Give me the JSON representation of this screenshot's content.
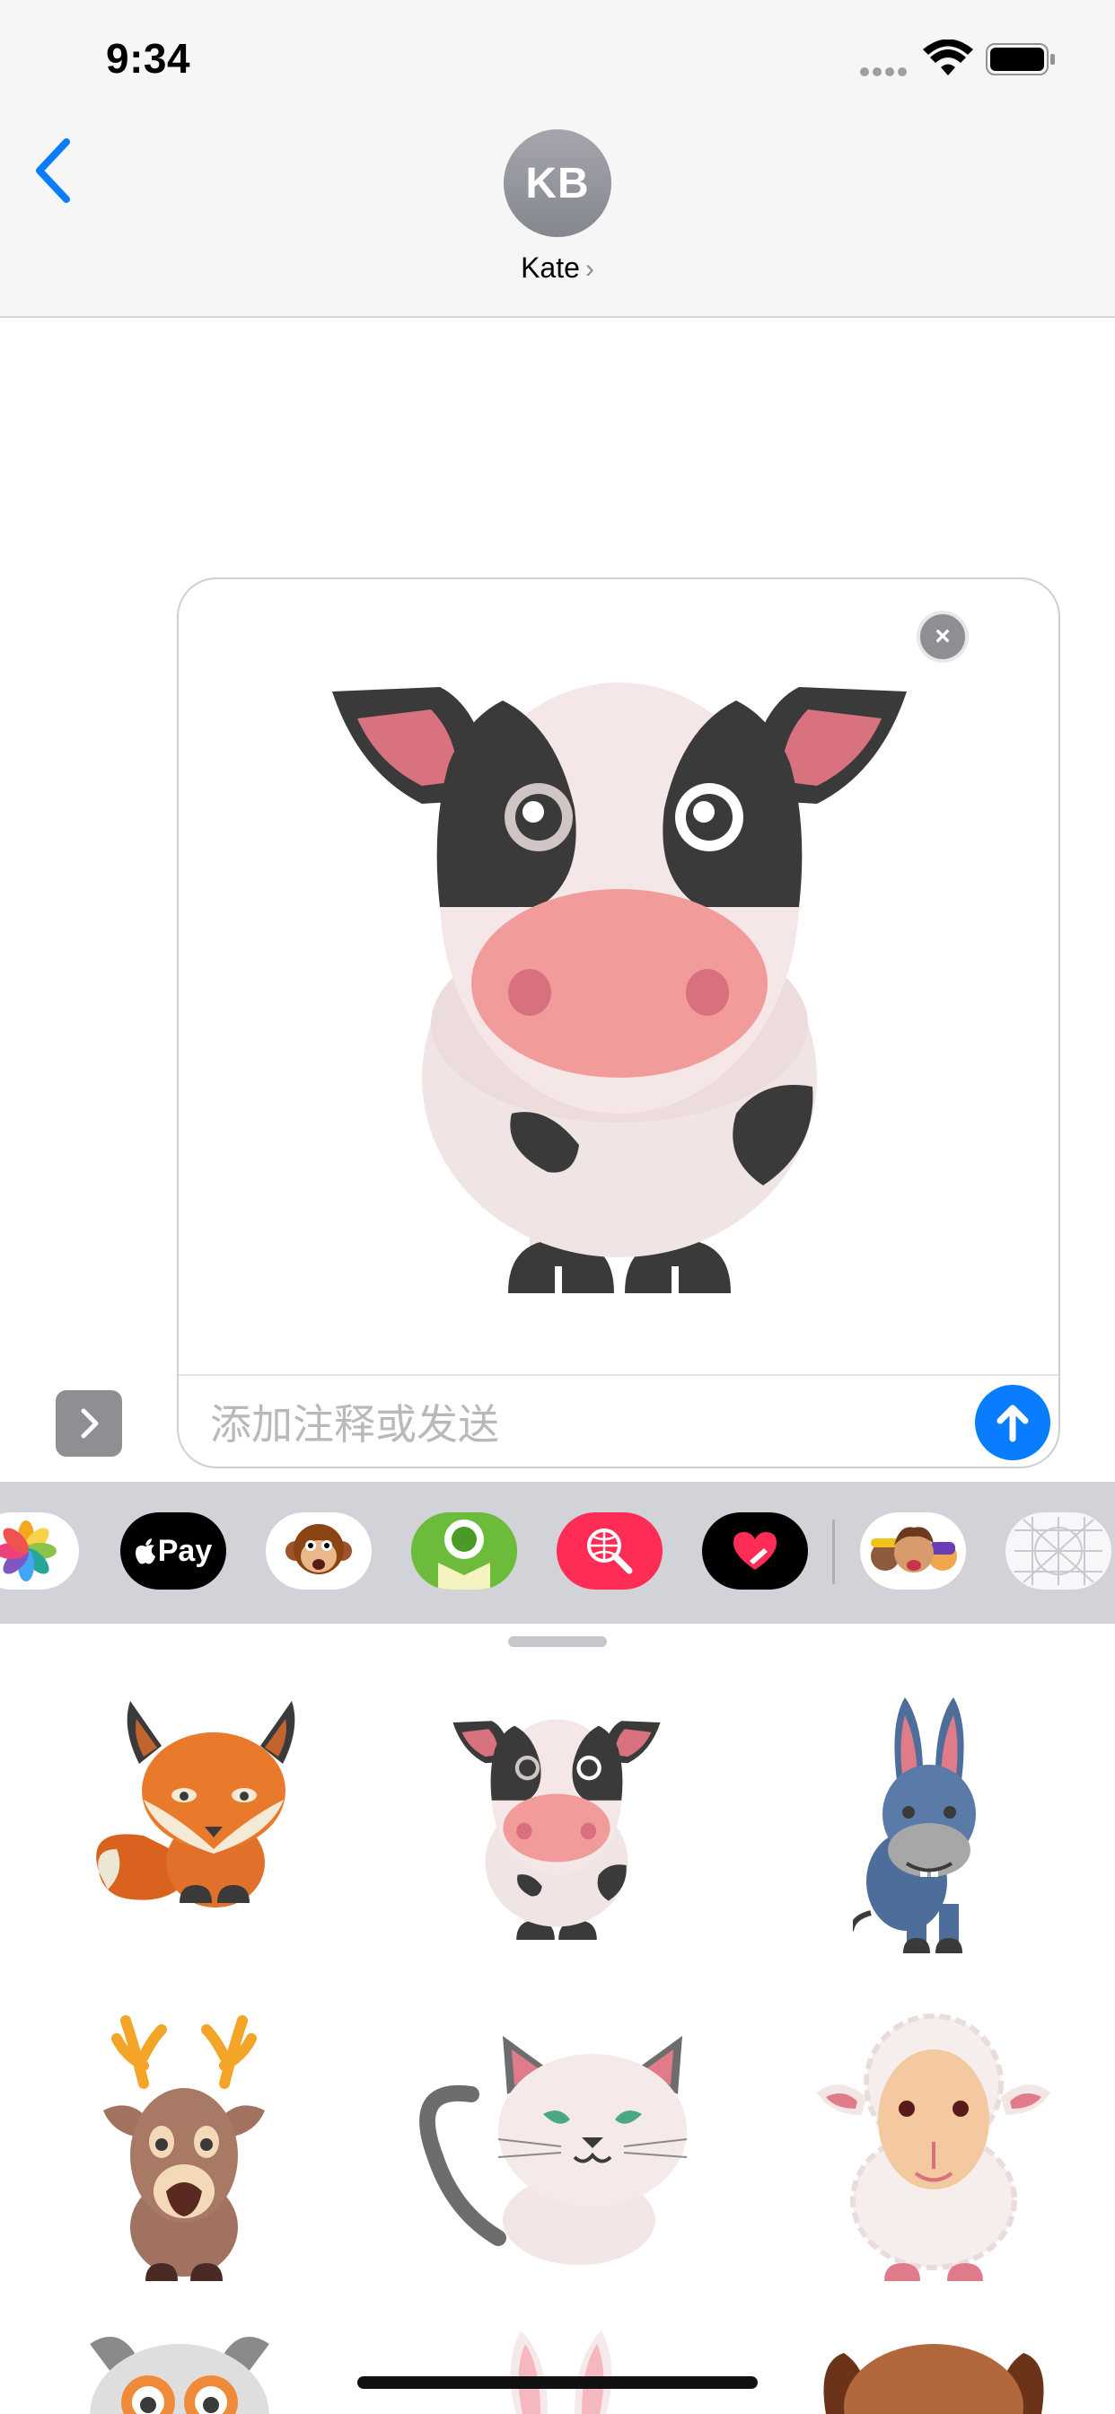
{
  "status_bar": {
    "time": "9:34"
  },
  "header": {
    "avatar_initials": "KB",
    "contact_name": "Kate",
    "contact_chevron": "›"
  },
  "compose": {
    "placeholder": "添加注释或发送",
    "remove_icon": "×",
    "attached_sticker": "cow-sticker"
  },
  "apps": [
    {
      "name": "photos-app-icon"
    },
    {
      "name": "apple-pay-app-icon",
      "label": "Pay"
    },
    {
      "name": "animoji-app-icon"
    },
    {
      "name": "green-sticker-app-icon"
    },
    {
      "name": "images-search-app-icon"
    },
    {
      "name": "digital-touch-app-icon"
    },
    {
      "name": "memoji-app-icon"
    },
    {
      "name": "grid-sticker-app-icon"
    }
  ],
  "stickers": [
    "fox-sticker",
    "cow-sticker",
    "donkey-sticker",
    "deer-sticker",
    "cat-sticker",
    "sheep-sticker",
    "owl-sticker",
    "rabbit-sticker",
    "dog-sticker"
  ],
  "colors": {
    "accent": "#0a7cff",
    "strip_background": "#d1d3d9",
    "header_background": "#f6f6f6"
  }
}
